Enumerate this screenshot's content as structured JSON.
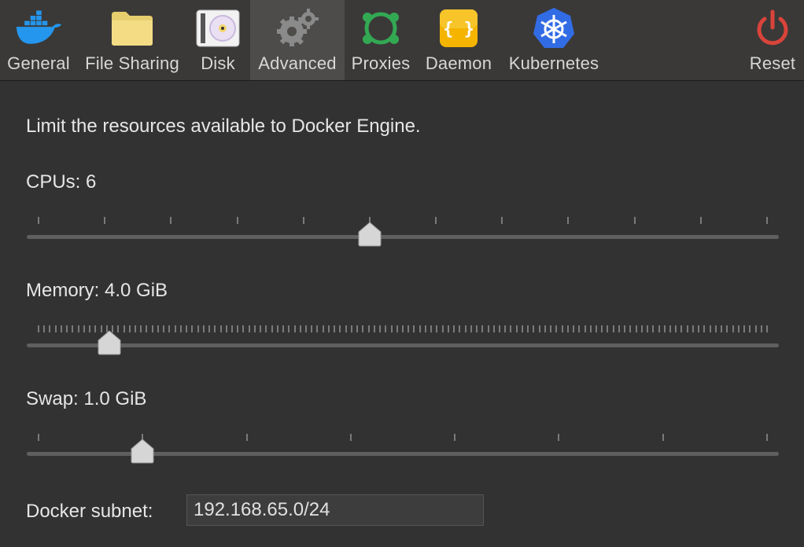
{
  "toolbar": {
    "items": [
      {
        "label": "General",
        "icon": "docker-whale-icon"
      },
      {
        "label": "File Sharing",
        "icon": "folder-icon"
      },
      {
        "label": "Disk",
        "icon": "disk-icon"
      },
      {
        "label": "Advanced",
        "icon": "gear-icon",
        "selected": true
      },
      {
        "label": "Proxies",
        "icon": "proxies-icon"
      },
      {
        "label": "Daemon",
        "icon": "daemon-braces-icon"
      },
      {
        "label": "Kubernetes",
        "icon": "kubernetes-wheel-icon"
      },
      {
        "label": "Reset",
        "icon": "power-icon"
      }
    ]
  },
  "main": {
    "intro": "Limit the resources available to Docker Engine.",
    "cpus": {
      "label": "CPUs: 6",
      "value": 6,
      "min": 1,
      "max": 12
    },
    "memory": {
      "label": "Memory: 4.0 GiB",
      "value": 4.0,
      "unit": "GiB"
    },
    "swap": {
      "label": "Swap: 1.0 GiB",
      "value": 1.0,
      "unit": "GiB"
    },
    "subnet": {
      "label": "Docker subnet:",
      "value": "192.168.65.0/24"
    }
  },
  "colors": {
    "background": "#323232",
    "toolbar": "#3a3938",
    "selected_tab": "#4d4c4b",
    "docker_blue": "#2496ed",
    "kubernetes_blue": "#326ce5",
    "reset_red": "#d9443a"
  }
}
